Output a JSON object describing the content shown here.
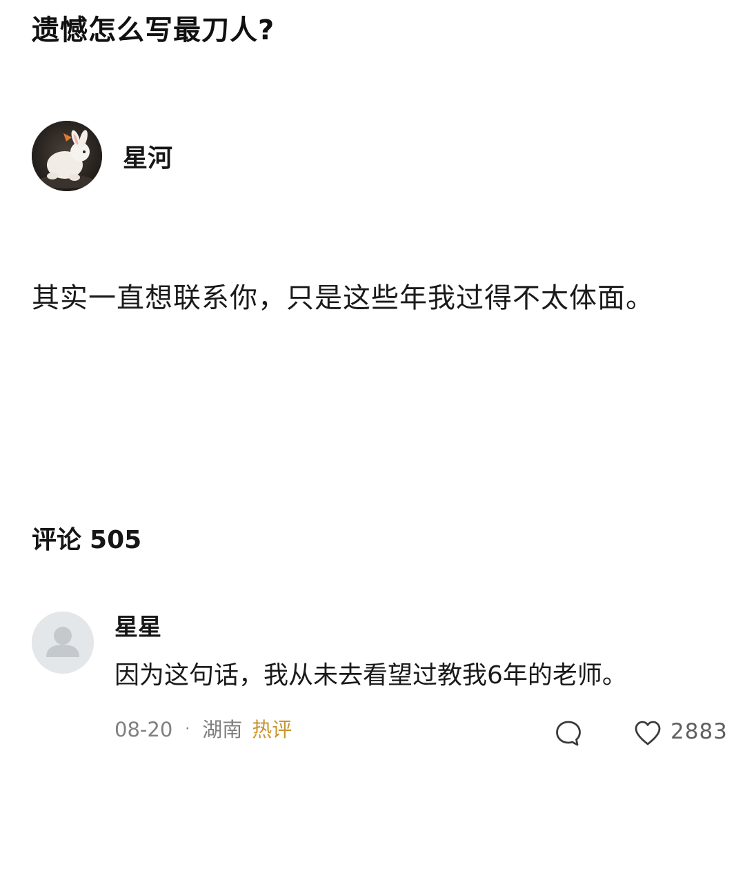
{
  "question": {
    "title": "遗憾怎么写最刀人?"
  },
  "answer": {
    "author_name": "星河",
    "author_avatar": "rabbit-avatar-icon",
    "body": "其实一直想联系你，只是这些年我过得不太体面。"
  },
  "comments_section": {
    "label": "评论",
    "count": "505"
  },
  "comments": [
    {
      "user_name": "星星",
      "avatar": "default-user-avatar-icon",
      "text": "因为这句话，我从未去看望过教我6年的老师。",
      "date": "08-20",
      "separator": "·",
      "location": "湖南",
      "badge": "热评",
      "reply_icon": "comment-bubble-icon",
      "like_icon": "heart-icon",
      "like_count": "2883"
    }
  ],
  "colors": {
    "text_primary": "#161616",
    "meta_gray": "#7f7f7f",
    "hot_badge": "#c7962f",
    "avatar_placeholder_bg": "#e4e7ea"
  }
}
